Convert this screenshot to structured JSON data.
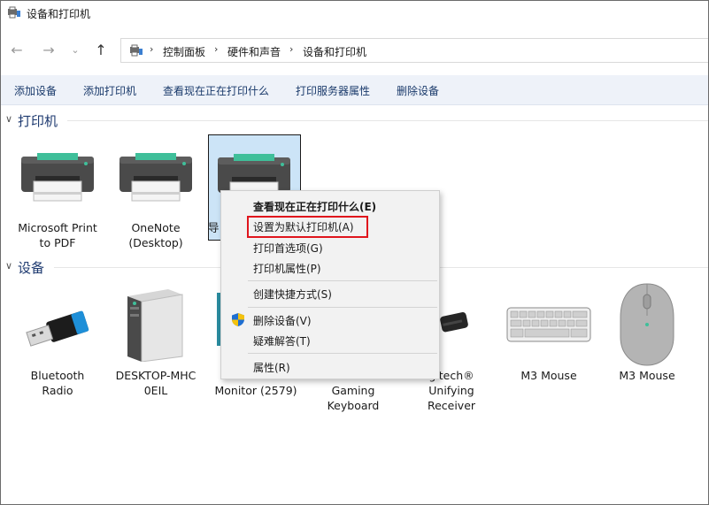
{
  "window": {
    "title": "设备和打印机"
  },
  "nav": {
    "back_icon": "back-arrow-icon",
    "forward_icon": "forward-arrow-icon",
    "history_icon": "chevron-down-icon",
    "up_icon": "up-arrow-icon",
    "breadcrumb": [
      "控制面板",
      "硬件和声音",
      "设备和打印机"
    ]
  },
  "commands": [
    "添加设备",
    "添加打印机",
    "查看现在正在打印什么",
    "打印服务器属性",
    "删除设备"
  ],
  "groups": {
    "printers": {
      "title": "打印机"
    },
    "devices": {
      "title": "设备"
    }
  },
  "printers": [
    {
      "label": "Microsoft Print\nto PDF"
    },
    {
      "label": "OneNote\n(Desktop)"
    },
    {
      "label": "导"
    }
  ],
  "devices": [
    {
      "label": "Bluetooth\nRadio",
      "icon": "usb-dongle-icon"
    },
    {
      "label": "DESKTOP-MHC\n0EIL",
      "icon": "computer-tower-icon"
    },
    {
      "label": "Monitor (2579)",
      "icon": "monitor-icon"
    },
    {
      "label": "Gaming\nKeyboard",
      "icon": "keyboard-icon"
    },
    {
      "label": "gitech®\nUnifying\nReceiver",
      "icon": "usb-receiver-icon"
    },
    {
      "label": "M3 Mouse",
      "icon": "keyboard-icon"
    },
    {
      "label": "M3 Mouse",
      "icon": "mouse-icon"
    }
  ],
  "context_menu": {
    "items": [
      {
        "label": "查看现在正在打印什么(E)",
        "bold": true
      },
      {
        "label": "设置为默认打印机(A)",
        "highlighted": true
      },
      {
        "label": "打印首选项(G)"
      },
      {
        "label": "打印机属性(P)"
      },
      {
        "label": "创建快捷方式(S)"
      },
      {
        "label": "删除设备(V)",
        "icon": "uac-shield-icon"
      },
      {
        "label": "疑难解答(T)"
      },
      {
        "label": "属性(R)"
      }
    ]
  },
  "colors": {
    "highlight_border": "#e0151d",
    "command_bar": "#eef2f9",
    "selection": "#cce4f7",
    "group_title": "#1e3a70"
  }
}
